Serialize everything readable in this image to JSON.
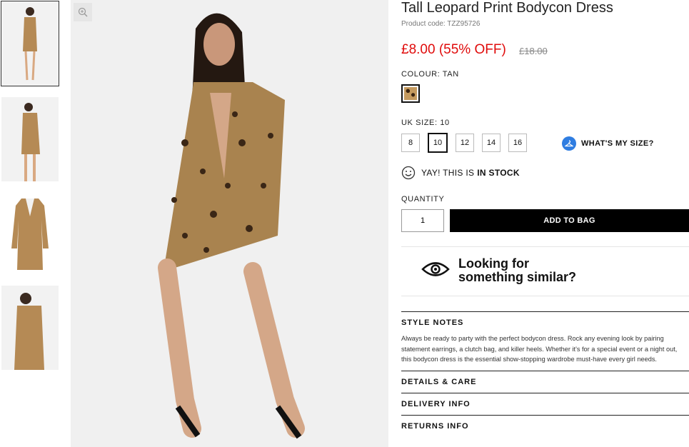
{
  "thumbnails": [
    {
      "alt": "Front view"
    },
    {
      "alt": "Side view"
    },
    {
      "alt": "Flat lay"
    },
    {
      "alt": "Detail view"
    }
  ],
  "main_image": {
    "zoom_icon": "zoom-in-icon"
  },
  "product": {
    "title": "Tall Leopard Print Bodycon Dress",
    "code": "Product code: TZZ95726",
    "price": "£8.00 (55% OFF)",
    "was_price": "£18.00"
  },
  "colour": {
    "label": "COLOUR:",
    "value": "TAN"
  },
  "size": {
    "label": "UK SIZE:",
    "value": "10",
    "options": [
      "8",
      "10",
      "12",
      "14",
      "16"
    ],
    "selected_index": 1,
    "guide_label": "WHAT'S MY SIZE?"
  },
  "stock": {
    "prefix": "YAY! THIS IS",
    "status": "IN STOCK"
  },
  "quantity": {
    "label": "QUANTITY",
    "value": "1"
  },
  "cta": {
    "add_to_bag": "ADD TO BAG"
  },
  "similar": {
    "line1": "Looking for",
    "line2": "something similar?"
  },
  "style_notes": {
    "title": "STYLE NOTES",
    "body": "Always be ready to party with the perfect bodycon dress. Rock any evening look by pairing statement earrings, a clutch bag, and killer heels. Whether it's for a special event or a night out, this bodycon dress is the essential show-stopping wardrobe must-have every girl needs."
  },
  "accordions": [
    {
      "title": "DETAILS & CARE"
    },
    {
      "title": "DELIVERY INFO"
    },
    {
      "title": "RETURNS INFO"
    }
  ],
  "colors": {
    "sale": "#e00b0b",
    "accent": "#2f7de1",
    "button": "#000000"
  }
}
